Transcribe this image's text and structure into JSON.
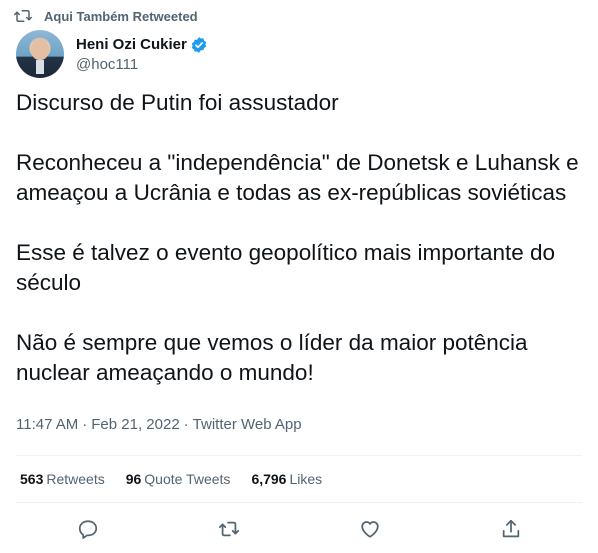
{
  "retweet_banner": {
    "icon": "retweet-icon",
    "text": "Aqui Também Retweeted"
  },
  "author": {
    "display_name": "Heni Ozi Cukier",
    "handle": "@hoc111",
    "verified": true,
    "verified_color": "#1d9bf0"
  },
  "tweet": {
    "paragraphs": [
      "Discurso de Putin foi assustador",
      "Reconheceu a \"independência\" de Donetsk e Luhansk e ameaçou a Ucrânia e todas as ex-repúblicas soviéticas",
      "Esse é talvez o evento geopolítico mais importante do século",
      "Não é sempre que vemos o líder da maior potência nuclear ameaçando o mundo!"
    ],
    "time": "11:47 AM",
    "date": "Feb 21, 2022",
    "source": "Twitter Web App",
    "separator": "·"
  },
  "stats": {
    "retweets_count": "563",
    "retweets_label": "Retweets",
    "quotes_count": "96",
    "quotes_label": "Quote Tweets",
    "likes_count": "6,796",
    "likes_label": "Likes"
  },
  "actions": {
    "reply_icon": "reply-icon",
    "retweet_icon": "retweet-icon",
    "like_icon": "like-icon",
    "share_icon": "share-icon"
  },
  "colors": {
    "text": "#0f1419",
    "secondary": "#536471",
    "divider": "#eff3f4"
  }
}
